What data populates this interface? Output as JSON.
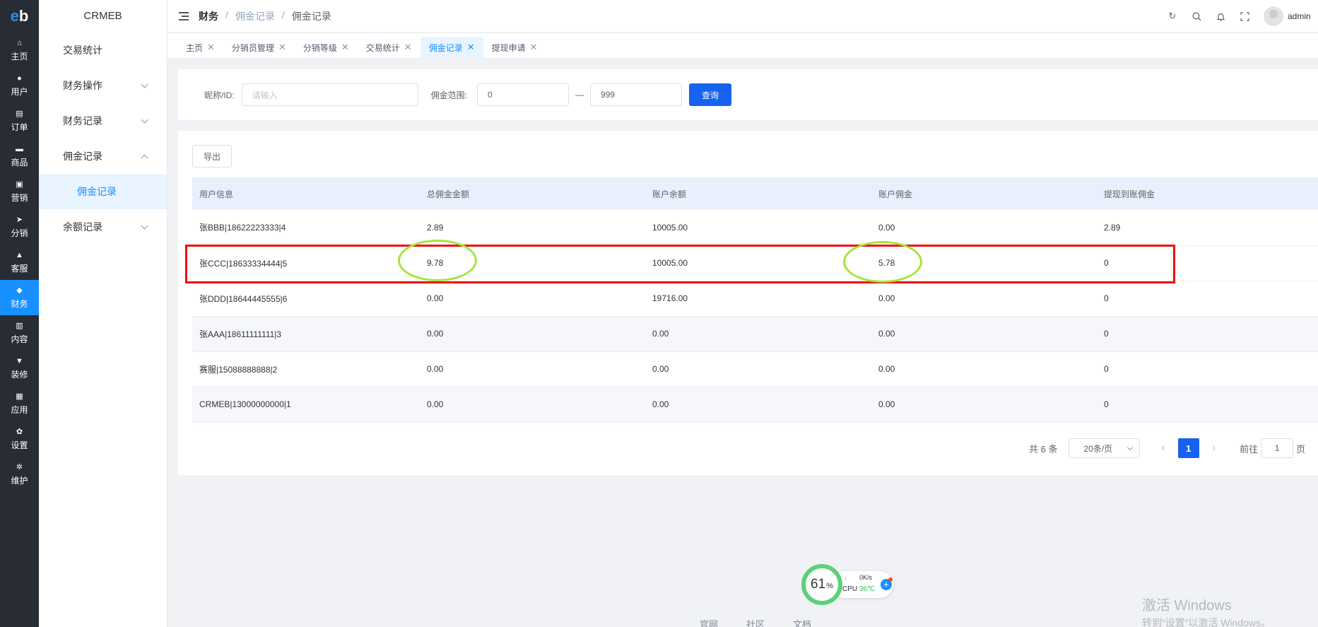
{
  "rail": {
    "logo": "eb",
    "items": [
      {
        "label": "主页",
        "icon": "home-icon",
        "glyph": "⌂"
      },
      {
        "label": "用户",
        "icon": "user-icon",
        "glyph": "●"
      },
      {
        "label": "订单",
        "icon": "order-icon",
        "glyph": "▤"
      },
      {
        "label": "商品",
        "icon": "goods-icon",
        "glyph": "▬"
      },
      {
        "label": "营销",
        "icon": "marketing-icon",
        "glyph": "▣"
      },
      {
        "label": "分销",
        "icon": "distribution-icon",
        "glyph": "➤"
      },
      {
        "label": "客服",
        "icon": "service-icon",
        "glyph": "▲"
      },
      {
        "label": "财务",
        "icon": "finance-icon",
        "glyph": "◆"
      },
      {
        "label": "内容",
        "icon": "content-icon",
        "glyph": "▥"
      },
      {
        "label": "装修",
        "icon": "decoration-icon",
        "glyph": "▼"
      },
      {
        "label": "应用",
        "icon": "apps-icon",
        "glyph": "▦"
      },
      {
        "label": "设置",
        "icon": "settings-icon",
        "glyph": "✿"
      },
      {
        "label": "维护",
        "icon": "maintenance-icon",
        "glyph": "✲"
      }
    ],
    "active_index": 7
  },
  "submenu": {
    "brand": "CRMEB",
    "items": [
      "交易统计",
      "财务操作",
      "财务记录",
      "佣金记录",
      "佣金记录",
      "余额记录"
    ]
  },
  "header": {
    "crumbs": [
      "财务",
      "/",
      "佣金记录",
      "/",
      "佣金记录"
    ],
    "user": "admin"
  },
  "tabs": [
    "主页",
    "分销员管理",
    "分销等级",
    "交易统计",
    "佣金记录",
    "提现申请"
  ],
  "filter": {
    "nickname_label": "昵称/ID:",
    "nickname_placeholder": "请输入",
    "range_label": "佣金范围:",
    "range_min": "0",
    "range_sep": "—",
    "range_max": "999",
    "search_button": "查询"
  },
  "table": {
    "export_button": "导出",
    "columns": [
      "用户信息",
      "总佣金金额",
      "账户余额",
      "账户佣金",
      "提现到账佣金"
    ],
    "rows": [
      [
        "张BBB|18622223333|4",
        "2.89",
        "10005.00",
        "0.00",
        "2.89"
      ],
      [
        "张CCC|18633334444|5",
        "9.78",
        "10005.00",
        "5.78",
        "0"
      ],
      [
        "张DDD|18644445555|6",
        "0.00",
        "19716.00",
        "0.00",
        "0"
      ],
      [
        "张AAA|18611111111|3",
        "0.00",
        "0.00",
        "0.00",
        "0"
      ],
      [
        "赛服|15088888888|2",
        "0.00",
        "0.00",
        "0.00",
        "0"
      ],
      [
        "CRMEB|13000000000|1",
        "0.00",
        "0.00",
        "0.00",
        "0"
      ]
    ]
  },
  "pager": {
    "total": "共 6 条",
    "page_size": "20条/页",
    "prev": "‹",
    "current": "1",
    "next": "›",
    "goto_label": "前往",
    "goto_value": "1",
    "goto_suffix": "页"
  },
  "footer": [
    "官网",
    "社区",
    "文档"
  ],
  "widget": {
    "percent": "61",
    "percent_unit": "%",
    "speed": "0K/s",
    "cpu_label": "CPU",
    "cpu_temp": "36℃",
    "plus": "+",
    "arrow": "↓"
  },
  "watermark": {
    "line1": "激活 Windows",
    "line2": "转到“设置”以激活 Windows。"
  }
}
